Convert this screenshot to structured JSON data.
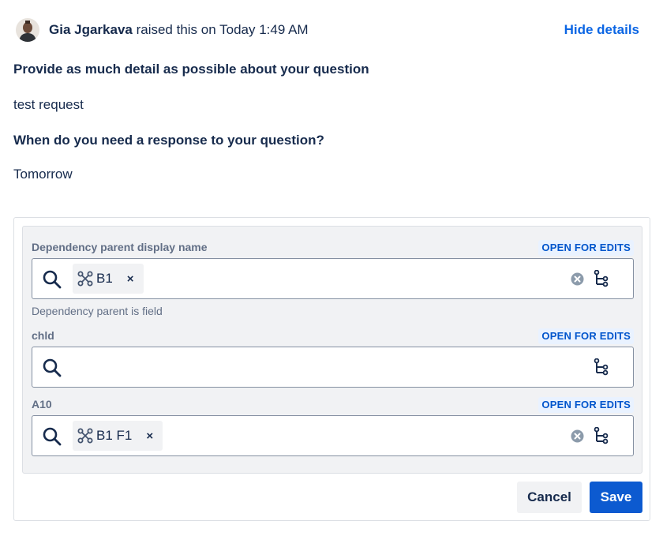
{
  "header": {
    "raiser_name": "Gia Jgarkava",
    "raised_text": " raised this on Today 1:49 AM",
    "hide_details": "Hide details"
  },
  "questions": [
    {
      "label": "Provide as much detail as possible about your question",
      "value": "test request"
    },
    {
      "label": "When do you need a response to your question?",
      "value": "Tomorrow"
    }
  ],
  "fields": [
    {
      "label": "Dependency parent display name",
      "badge": "OPEN FOR EDITS",
      "chip": "B1",
      "chip_remove": "×",
      "helper": "Dependency parent is field"
    },
    {
      "label": "chld",
      "badge": "OPEN FOR EDITS"
    },
    {
      "label": "A10",
      "badge": "OPEN FOR EDITS",
      "chip": "B1 F1",
      "chip_remove": "×"
    }
  ],
  "actions": {
    "cancel": "Cancel",
    "save": "Save"
  },
  "colors": {
    "link": "#0c66e4",
    "badge_bg": "#e9f2ff",
    "badge_text": "#0055cc",
    "primary": "#0c5ad0"
  },
  "icons": [
    "search-icon",
    "hierarchy-icon",
    "clear-icon",
    "tree-icon",
    "avatar"
  ]
}
